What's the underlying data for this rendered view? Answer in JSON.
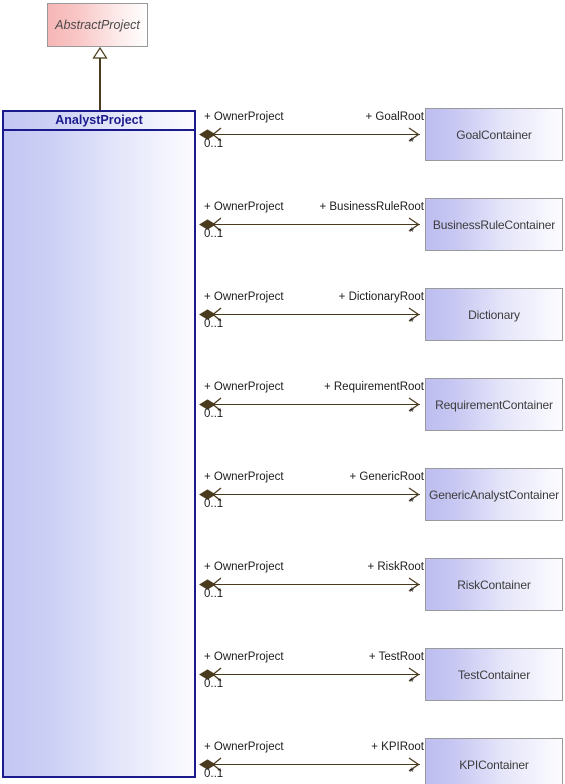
{
  "diagram": {
    "type": "uml-class-diagram",
    "background_color": "#ffffff",
    "line_color": "#4a3a1e"
  },
  "superclass": {
    "name": "AbstractProject",
    "stereotype_italic": true,
    "fill_start": "#f6b6b6",
    "fill_end": "#ffffff",
    "border_color": "#999999",
    "text_color": "#4a4a4a"
  },
  "generalization": {
    "arrow_kind": "hollow-triangle",
    "from": "AnalystProject",
    "to": "AbstractProject"
  },
  "main_class": {
    "name": "AnalystProject",
    "border_color": "#1a1a8c",
    "title_color": "#1a1a8c",
    "fill_start": "#c3c6f2",
    "fill_end": "#fbfbff"
  },
  "associations": [
    {
      "source_role": "+ OwnerProject",
      "source_multiplicity": "0..1",
      "target_role": "+ GoalRoot",
      "target_multiplicity": "*",
      "target_class": "GoalContainer"
    },
    {
      "source_role": "+ OwnerProject",
      "source_multiplicity": "0..1",
      "target_role": "+ BusinessRuleRoot",
      "target_multiplicity": "*",
      "target_class": "BusinessRuleContainer"
    },
    {
      "source_role": "+ OwnerProject",
      "source_multiplicity": "0..1",
      "target_role": "+ DictionaryRoot",
      "target_multiplicity": "*",
      "target_class": "Dictionary"
    },
    {
      "source_role": "+ OwnerProject",
      "source_multiplicity": "0..1",
      "target_role": "+ RequirementRoot",
      "target_multiplicity": "*",
      "target_class": "RequirementContainer"
    },
    {
      "source_role": "+ OwnerProject",
      "source_multiplicity": "0..1",
      "target_role": "+ GenericRoot",
      "target_multiplicity": "*",
      "target_class": "GenericAnalystContainer"
    },
    {
      "source_role": "+ OwnerProject",
      "source_multiplicity": "0..1",
      "target_role": "+ RiskRoot",
      "target_multiplicity": "*",
      "target_class": "RiskContainer"
    },
    {
      "source_role": "+ OwnerProject",
      "source_multiplicity": "0..1",
      "target_role": "+ TestRoot",
      "target_multiplicity": "*",
      "target_class": "TestContainer"
    },
    {
      "source_role": "+ OwnerProject",
      "source_multiplicity": "0..1",
      "target_role": "+ KPIRoot",
      "target_multiplicity": "*",
      "target_class": "KPIContainer"
    }
  ]
}
